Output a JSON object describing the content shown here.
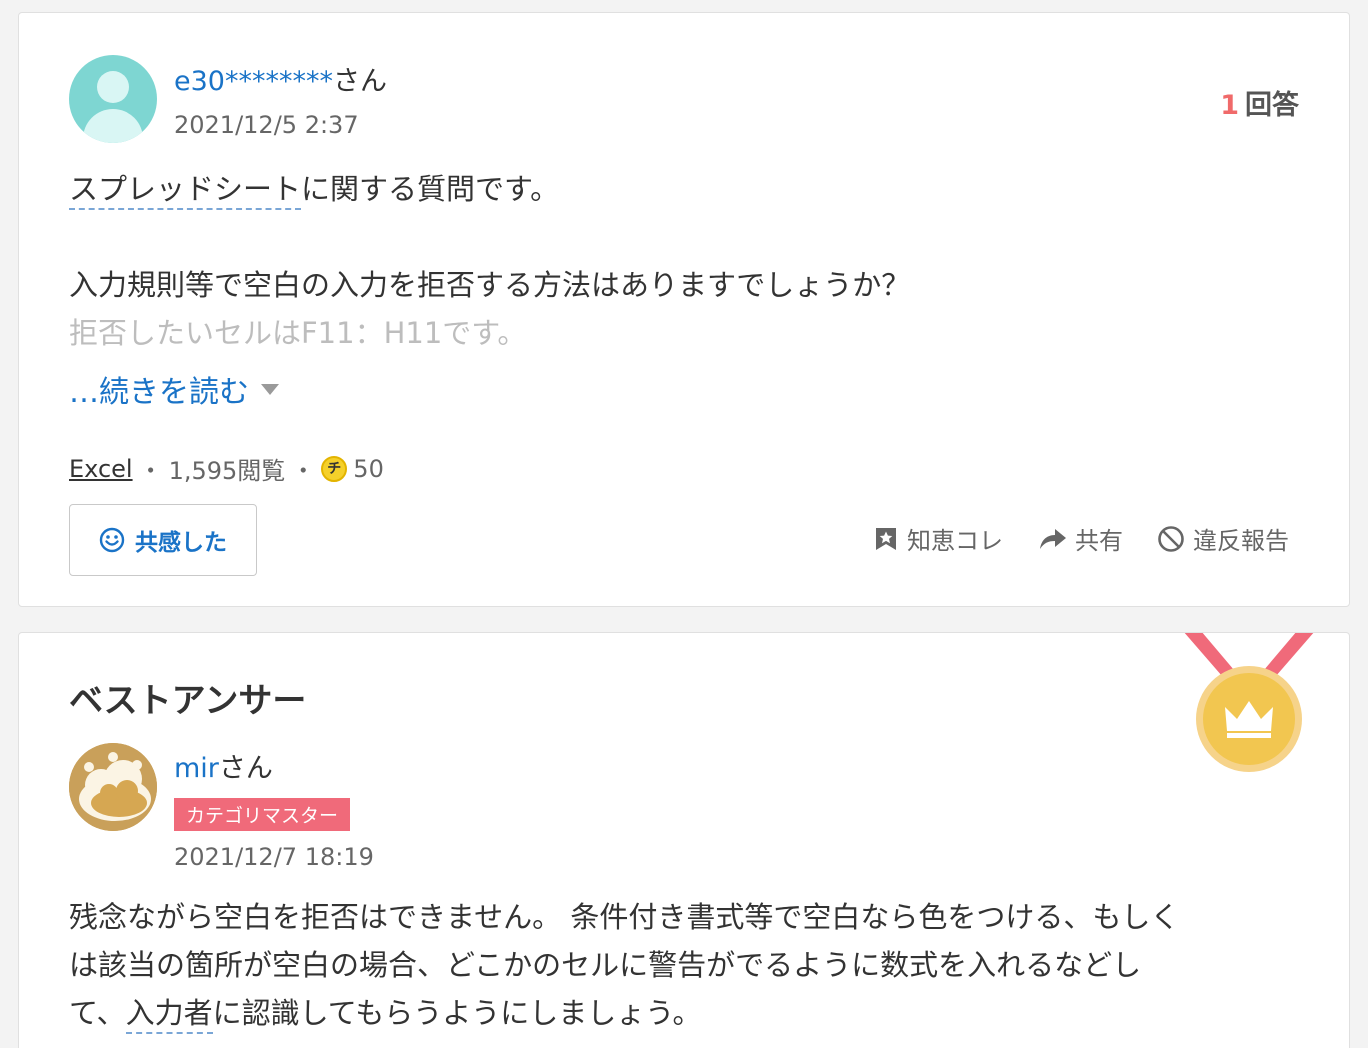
{
  "question": {
    "user_id": "e30********",
    "honorific": "さん",
    "date": "2021/12/5 2:37",
    "answer_count": "1",
    "answer_count_label": "回答",
    "keyword": "スプレッドシート",
    "line1_rest": "に関する質問です。",
    "line2": "入力規則等で空白の入力を拒否する方法はありますでしょうか？",
    "line3": "拒否したいセルはF11：H11です。",
    "read_more": "…続きを読む",
    "category": "Excel",
    "separator": "・",
    "views": "1,595閲覧",
    "coin_symbol": "チ",
    "coins": "50",
    "empathy_label": "共感した",
    "actions": {
      "chie_kore": "知恵コレ",
      "share": "共有",
      "report": "違反報告"
    }
  },
  "answer": {
    "title": "ベストアンサー",
    "user_id": "mir",
    "honorific": "さん",
    "badge": "カテゴリマスター",
    "date": "2021/12/7 18:19",
    "line1": "残念ながら空白を拒否はできません。 条件付き書式等で空白なら色をつける、もしく",
    "line2": "は該当の箇所が空白の場合、どこかのセルに警告がでるように数式を入れるなどし",
    "line3_pre": "て、",
    "keyword": "入力者",
    "line3_post": "に認識してもらうようにしましょう。"
  }
}
